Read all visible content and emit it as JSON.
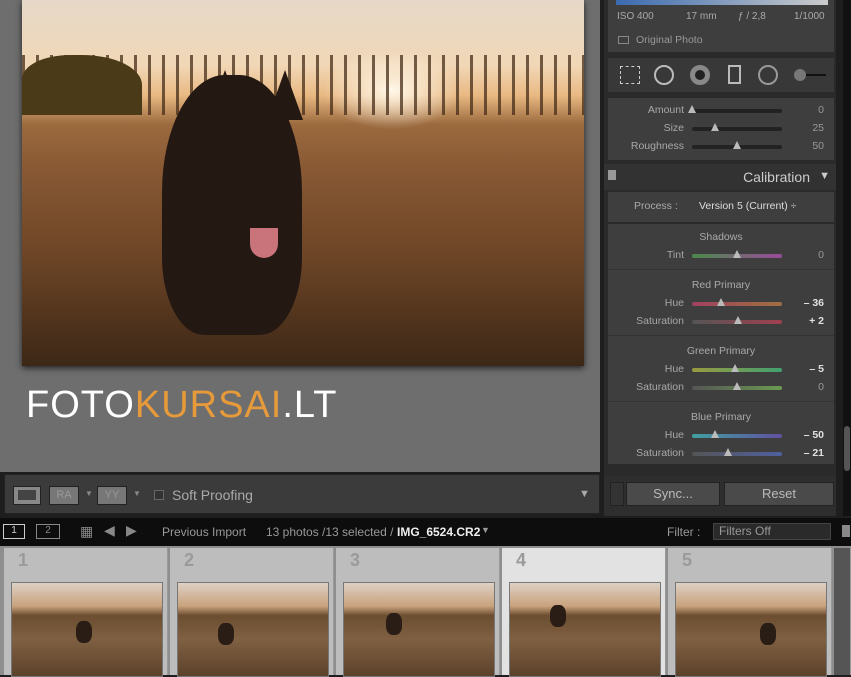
{
  "logo": {
    "part1": "FOTO",
    "part2": "KURSAI",
    "part3": ".LT"
  },
  "exif": {
    "iso": "ISO 400",
    "focal": "17 mm",
    "aperture": "ƒ / 2,8",
    "shutter": "1/1000",
    "original_photo": "Original Photo"
  },
  "tools": [
    "crop-overlay-icon",
    "spot-removal-icon",
    "red-eye-icon",
    "graduated-filter-icon",
    "radial-filter-icon",
    "adjustment-brush-icon"
  ],
  "grain": {
    "rows": [
      {
        "label": "Amount",
        "value": "0",
        "fraction": 0
      },
      {
        "label": "Size",
        "value": "25",
        "fraction": 0.25
      },
      {
        "label": "Roughness",
        "value": "50",
        "fraction": 0.5
      }
    ]
  },
  "calibration": {
    "title": "Calibration",
    "process_label": "Process :",
    "process_value": "Version 5 (Current) ÷",
    "groups": [
      {
        "title": "Shadows",
        "rows": [
          {
            "label": "Tint",
            "value": "0",
            "fraction": 0.5,
            "gradient": "#4a8a4a,#9a4a9a",
            "bold": false
          }
        ]
      },
      {
        "title": "Red Primary",
        "rows": [
          {
            "label": "Hue",
            "value": "– 36",
            "fraction": 0.32,
            "gradient": "#a04060,#a07040",
            "bold": true
          },
          {
            "label": "Saturation",
            "value": "+ 2",
            "fraction": 0.51,
            "gradient": "#555,#a04050",
            "bold": true
          }
        ]
      },
      {
        "title": "Green Primary",
        "rows": [
          {
            "label": "Hue",
            "value": "– 5",
            "fraction": 0.475,
            "gradient": "#9a9a40,#40a070",
            "bold": true
          },
          {
            "label": "Saturation",
            "value": "0",
            "fraction": 0.5,
            "gradient": "#555,#6a9a50",
            "bold": false
          }
        ]
      },
      {
        "title": "Blue Primary",
        "rows": [
          {
            "label": "Hue",
            "value": "– 50",
            "fraction": 0.25,
            "gradient": "#40a0a0,#6050a0",
            "bold": true
          },
          {
            "label": "Saturation",
            "value": "– 21",
            "fraction": 0.395,
            "gradient": "#555,#5060a0",
            "bold": true
          }
        ]
      }
    ]
  },
  "buttons": {
    "sync": "Sync...",
    "reset": "Reset"
  },
  "toolbar": {
    "before_after_1": "RA",
    "before_after_2": "YY",
    "soft_proofing": "Soft Proofing"
  },
  "filmstrip_bar": {
    "view1": "1",
    "view2": "2",
    "source": "Previous Import",
    "count": "13 photos /13 selected /",
    "filename": "IMG_6524.CR2",
    "filter_label": "Filter :",
    "filter_value": "Filters Off"
  },
  "filmstrip": [
    {
      "number": "1",
      "selected": false
    },
    {
      "number": "2",
      "selected": false
    },
    {
      "number": "3",
      "selected": false
    },
    {
      "number": "4",
      "selected": true
    },
    {
      "number": "5",
      "selected": false
    }
  ],
  "colors": {
    "accent_logo": "#e69a3a",
    "loupe_bg": "#6e6e6e",
    "panel_bg": "#3e3e3e"
  }
}
